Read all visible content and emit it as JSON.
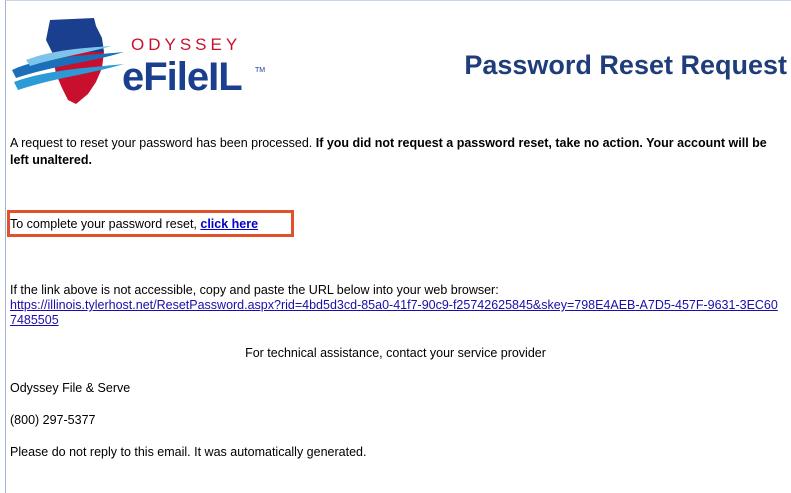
{
  "header": {
    "logo_top_text": "ODYSSEY",
    "logo_main_text": "eFileIL",
    "logo_tm": "TM",
    "title": "Password Reset Request"
  },
  "body": {
    "intro_text": "A request to reset your password has been processed. ",
    "intro_bold": "If you did not request a password reset, take no action. Your account will be left unaltered.",
    "complete_text": "To complete your password reset, ",
    "complete_link": "click here",
    "access_text": "If the link above is not accessible, copy and paste the URL below into your web browser:",
    "reset_url": "https://illinois.tylerhost.net/ResetPassword.aspx?rid=4bd5d3cd-85a0-41f7-90c9-f25742625845&skey=798E4AEB-A7D5-457F-9631-3EC607485505",
    "tech_assistance": "For technical assistance, contact your service provider",
    "company": "Odyssey File & Serve",
    "phone": "(800) 297-5377",
    "no_reply": "Please do not reply to this email. It was automatically generated."
  },
  "colors": {
    "brand_blue": "#1b3f8f",
    "brand_red": "#c8102e",
    "highlight_border": "#e0522b",
    "link": "#0000cc"
  }
}
